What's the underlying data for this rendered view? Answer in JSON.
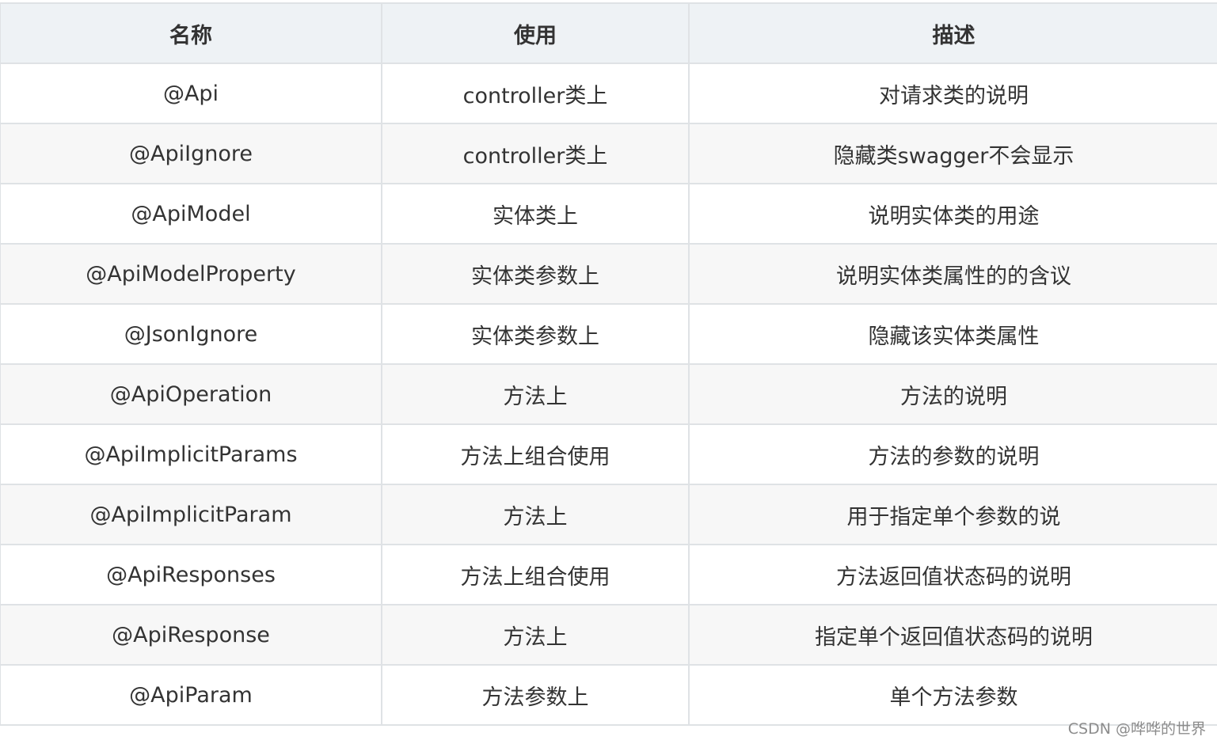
{
  "table": {
    "headers": [
      "名称",
      "使用",
      "描述"
    ],
    "rows": [
      [
        "@Api",
        "controller类上",
        "对请求类的说明"
      ],
      [
        "@ApiIgnore",
        "controller类上",
        "隐藏类swagger不会显示"
      ],
      [
        "@ApiModel",
        "实体类上",
        "说明实体类的用途"
      ],
      [
        "@ApiModelProperty",
        "实体类参数上",
        "说明实体类属性的的含议"
      ],
      [
        "@JsonIgnore",
        "实体类参数上",
        "隐藏该实体类属性"
      ],
      [
        "@ApiOperation",
        "方法上",
        "方法的说明"
      ],
      [
        "@ApiImplicitParams",
        "方法上组合使用",
        "方法的参数的说明"
      ],
      [
        "@ApiImplicitParam",
        "方法上",
        "用于指定单个参数的说"
      ],
      [
        "@ApiResponses",
        "方法上组合使用",
        "方法返回值状态码的说明"
      ],
      [
        "@ApiResponse",
        "方法上",
        "指定单个返回值状态码的说明"
      ],
      [
        "@ApiParam",
        "方法参数上",
        "单个方法参数"
      ]
    ]
  },
  "watermark": "CSDN @哗哗的世界",
  "colors": {
    "header_bg": "#eef2f5",
    "stripe_bg": "#f7f7f7",
    "border": "#dfe2e5",
    "text": "#333333"
  }
}
